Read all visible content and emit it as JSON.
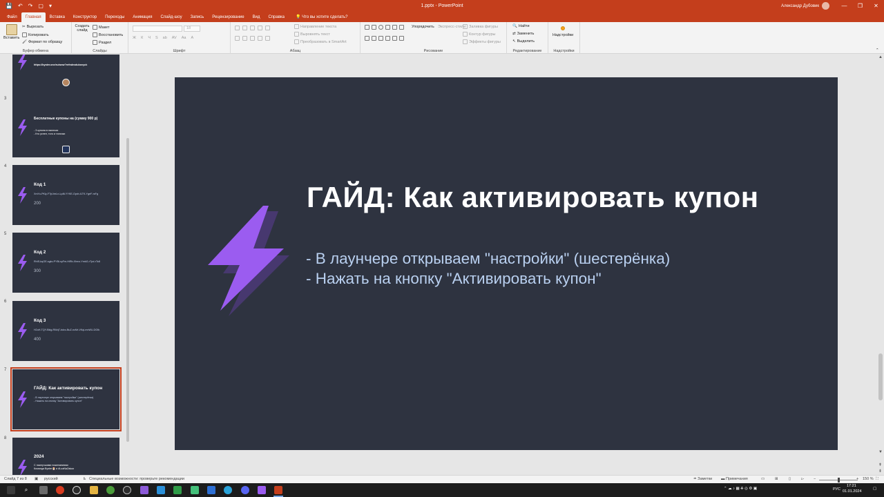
{
  "window": {
    "title": "1.pptx  -  PowerPoint",
    "user": "Александр Дубовик",
    "controls": [
      "—",
      "❐",
      "✕"
    ],
    "qat": [
      "💾",
      "↶",
      "↷",
      "▢",
      "▾"
    ]
  },
  "tabs": [
    "Файл",
    "Главная",
    "Вставка",
    "Конструктор",
    "Переходы",
    "Анимация",
    "Слайд-шоу",
    "Запись",
    "Рецензирование",
    "Вид",
    "Справка"
  ],
  "active_tab": "Главная",
  "tell_me": "Что вы хотите сделать?",
  "ribbon": {
    "clipboard": {
      "paste": "Вставить",
      "cut": "Вырезать",
      "copy": "Копировать",
      "format_painter": "Формат по образцу",
      "label": "Буфер обмена"
    },
    "slides": {
      "new_slide": "Создать слайд",
      "layout": "Макет",
      "reset": "Восстановить",
      "section": "Раздел",
      "label": "Слайды"
    },
    "font": {
      "label": "Шрифт",
      "size": "18",
      "buttons": [
        "Ж",
        "К",
        "Ч",
        "S",
        "ab",
        "AV",
        "Aa",
        "A"
      ]
    },
    "paragraph": {
      "label": "Абзац",
      "text_direction": "Направление текста",
      "align_text": "Выровнять текст",
      "smartart": "Преобразовать в SmartArt"
    },
    "drawing": {
      "arrange": "Упорядочить",
      "quick_styles": "Экспресс-стили",
      "fill": "Заливка фигуры",
      "outline": "Контур фигуры",
      "effects": "Эффекты фигуры",
      "label": "Рисование"
    },
    "editing": {
      "find": "Найти",
      "replace": "Заменить",
      "select": "Выделить",
      "label": "Редактирование"
    },
    "addins": {
      "button": "Надстройки",
      "label": "Надстройки"
    }
  },
  "thumbnails": [
    {
      "num": "",
      "url": "https://byster.one/ru/wow?refralexdubovyck",
      "selected": false
    },
    {
      "num": "3",
      "title": "Бесплатные купоны на (сумму 900 р)",
      "lines": [
        "- 3 купона в наличии",
        "- Кто успел, того и тапочки"
      ],
      "selected": false
    },
    {
      "num": "4",
      "title": "Код 1",
      "code": "XmYu-PKly-FTyl-fmLn-Lp8t-YYKE-Oyvb-ILTK-YgeF-rsFg",
      "value": "200",
      "selected": false
    },
    {
      "num": "5",
      "title": "Код 2",
      "code": "RhIS-kqOE-sgkv-PYBi-syFm-HiRb-Xhmz-YmkG-rTpd-rTo8",
      "value": "300",
      "selected": false
    },
    {
      "num": "6",
      "title": "Код 3",
      "code": "H2uH-TQY-Bkig-RWqT-bdvc-BuZ-ncMr-VKqi-mnWU-DOIk",
      "value": "400",
      "selected": false
    },
    {
      "num": "7",
      "title": "ГАЙД: Как активировать купон",
      "lines": [
        "- В лаунчере открываем \"настройки\" (шестерёнка)",
        "- Нажать на кнопку \"Активировать купон\""
      ],
      "selected": true
    },
    {
      "num": "8",
      "title": "2024",
      "lines": [
        "С наилучшими пожеланиями",
        "Команда Byster🎅 и #LuaNaZakaz"
      ],
      "selected": false
    }
  ],
  "slide": {
    "title": "ГАЙД: Как активировать купон",
    "bullets": [
      "- В лаунчере открываем \"настройки\" (шестерёнка)",
      "- Нажать на кнопку \"Активировать купон\""
    ],
    "bolt_color": "#9b5cf0",
    "background": "#2e3340"
  },
  "status": {
    "slide_of": "Слайд 7 из 8",
    "language": "русский",
    "accessibility": "Специальные возможности: проверьте рекомендации",
    "notes": "Заметки",
    "comments": "Примечания",
    "zoom": "150 %"
  },
  "taskbar": {
    "lang": "РУС",
    "time": "17:21",
    "date": "01.01.2024"
  },
  "colors": {
    "accent": "#c43e1c",
    "slide_bg": "#2e3340",
    "bullet_text": "#b9d0f0"
  }
}
